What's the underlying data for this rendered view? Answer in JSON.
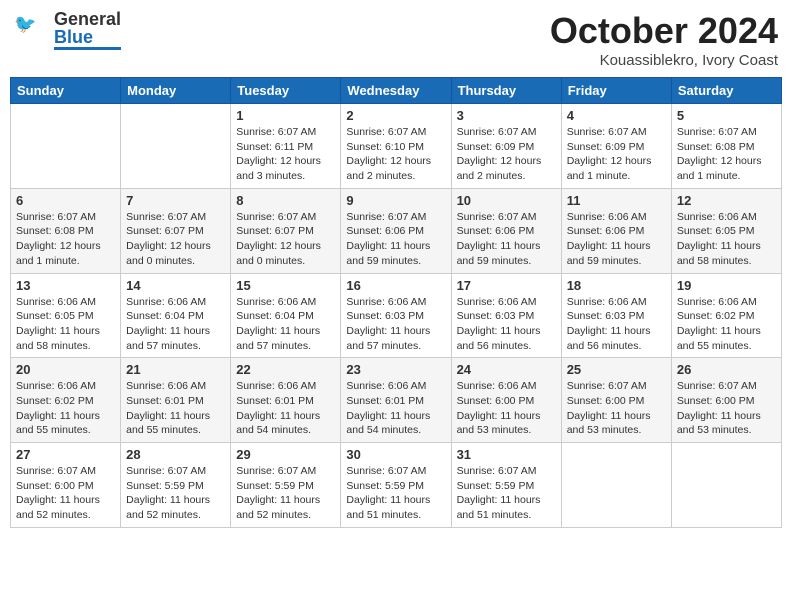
{
  "header": {
    "logo_general": "General",
    "logo_blue": "Blue",
    "title": "October 2024",
    "subtitle": "Kouassiblekro, Ivory Coast"
  },
  "days_of_week": [
    "Sunday",
    "Monday",
    "Tuesday",
    "Wednesday",
    "Thursday",
    "Friday",
    "Saturday"
  ],
  "weeks": [
    [
      {
        "day": "",
        "info": ""
      },
      {
        "day": "",
        "info": ""
      },
      {
        "day": "1",
        "info": "Sunrise: 6:07 AM\nSunset: 6:11 PM\nDaylight: 12 hours\nand 3 minutes."
      },
      {
        "day": "2",
        "info": "Sunrise: 6:07 AM\nSunset: 6:10 PM\nDaylight: 12 hours\nand 2 minutes."
      },
      {
        "day": "3",
        "info": "Sunrise: 6:07 AM\nSunset: 6:09 PM\nDaylight: 12 hours\nand 2 minutes."
      },
      {
        "day": "4",
        "info": "Sunrise: 6:07 AM\nSunset: 6:09 PM\nDaylight: 12 hours\nand 1 minute."
      },
      {
        "day": "5",
        "info": "Sunrise: 6:07 AM\nSunset: 6:08 PM\nDaylight: 12 hours\nand 1 minute."
      }
    ],
    [
      {
        "day": "6",
        "info": "Sunrise: 6:07 AM\nSunset: 6:08 PM\nDaylight: 12 hours\nand 1 minute."
      },
      {
        "day": "7",
        "info": "Sunrise: 6:07 AM\nSunset: 6:07 PM\nDaylight: 12 hours\nand 0 minutes."
      },
      {
        "day": "8",
        "info": "Sunrise: 6:07 AM\nSunset: 6:07 PM\nDaylight: 12 hours\nand 0 minutes."
      },
      {
        "day": "9",
        "info": "Sunrise: 6:07 AM\nSunset: 6:06 PM\nDaylight: 11 hours\nand 59 minutes."
      },
      {
        "day": "10",
        "info": "Sunrise: 6:07 AM\nSunset: 6:06 PM\nDaylight: 11 hours\nand 59 minutes."
      },
      {
        "day": "11",
        "info": "Sunrise: 6:06 AM\nSunset: 6:06 PM\nDaylight: 11 hours\nand 59 minutes."
      },
      {
        "day": "12",
        "info": "Sunrise: 6:06 AM\nSunset: 6:05 PM\nDaylight: 11 hours\nand 58 minutes."
      }
    ],
    [
      {
        "day": "13",
        "info": "Sunrise: 6:06 AM\nSunset: 6:05 PM\nDaylight: 11 hours\nand 58 minutes."
      },
      {
        "day": "14",
        "info": "Sunrise: 6:06 AM\nSunset: 6:04 PM\nDaylight: 11 hours\nand 57 minutes."
      },
      {
        "day": "15",
        "info": "Sunrise: 6:06 AM\nSunset: 6:04 PM\nDaylight: 11 hours\nand 57 minutes."
      },
      {
        "day": "16",
        "info": "Sunrise: 6:06 AM\nSunset: 6:03 PM\nDaylight: 11 hours\nand 57 minutes."
      },
      {
        "day": "17",
        "info": "Sunrise: 6:06 AM\nSunset: 6:03 PM\nDaylight: 11 hours\nand 56 minutes."
      },
      {
        "day": "18",
        "info": "Sunrise: 6:06 AM\nSunset: 6:03 PM\nDaylight: 11 hours\nand 56 minutes."
      },
      {
        "day": "19",
        "info": "Sunrise: 6:06 AM\nSunset: 6:02 PM\nDaylight: 11 hours\nand 55 minutes."
      }
    ],
    [
      {
        "day": "20",
        "info": "Sunrise: 6:06 AM\nSunset: 6:02 PM\nDaylight: 11 hours\nand 55 minutes."
      },
      {
        "day": "21",
        "info": "Sunrise: 6:06 AM\nSunset: 6:01 PM\nDaylight: 11 hours\nand 55 minutes."
      },
      {
        "day": "22",
        "info": "Sunrise: 6:06 AM\nSunset: 6:01 PM\nDaylight: 11 hours\nand 54 minutes."
      },
      {
        "day": "23",
        "info": "Sunrise: 6:06 AM\nSunset: 6:01 PM\nDaylight: 11 hours\nand 54 minutes."
      },
      {
        "day": "24",
        "info": "Sunrise: 6:06 AM\nSunset: 6:00 PM\nDaylight: 11 hours\nand 53 minutes."
      },
      {
        "day": "25",
        "info": "Sunrise: 6:07 AM\nSunset: 6:00 PM\nDaylight: 11 hours\nand 53 minutes."
      },
      {
        "day": "26",
        "info": "Sunrise: 6:07 AM\nSunset: 6:00 PM\nDaylight: 11 hours\nand 53 minutes."
      }
    ],
    [
      {
        "day": "27",
        "info": "Sunrise: 6:07 AM\nSunset: 6:00 PM\nDaylight: 11 hours\nand 52 minutes."
      },
      {
        "day": "28",
        "info": "Sunrise: 6:07 AM\nSunset: 5:59 PM\nDaylight: 11 hours\nand 52 minutes."
      },
      {
        "day": "29",
        "info": "Sunrise: 6:07 AM\nSunset: 5:59 PM\nDaylight: 11 hours\nand 52 minutes."
      },
      {
        "day": "30",
        "info": "Sunrise: 6:07 AM\nSunset: 5:59 PM\nDaylight: 11 hours\nand 51 minutes."
      },
      {
        "day": "31",
        "info": "Sunrise: 6:07 AM\nSunset: 5:59 PM\nDaylight: 11 hours\nand 51 minutes."
      },
      {
        "day": "",
        "info": ""
      },
      {
        "day": "",
        "info": ""
      }
    ]
  ]
}
